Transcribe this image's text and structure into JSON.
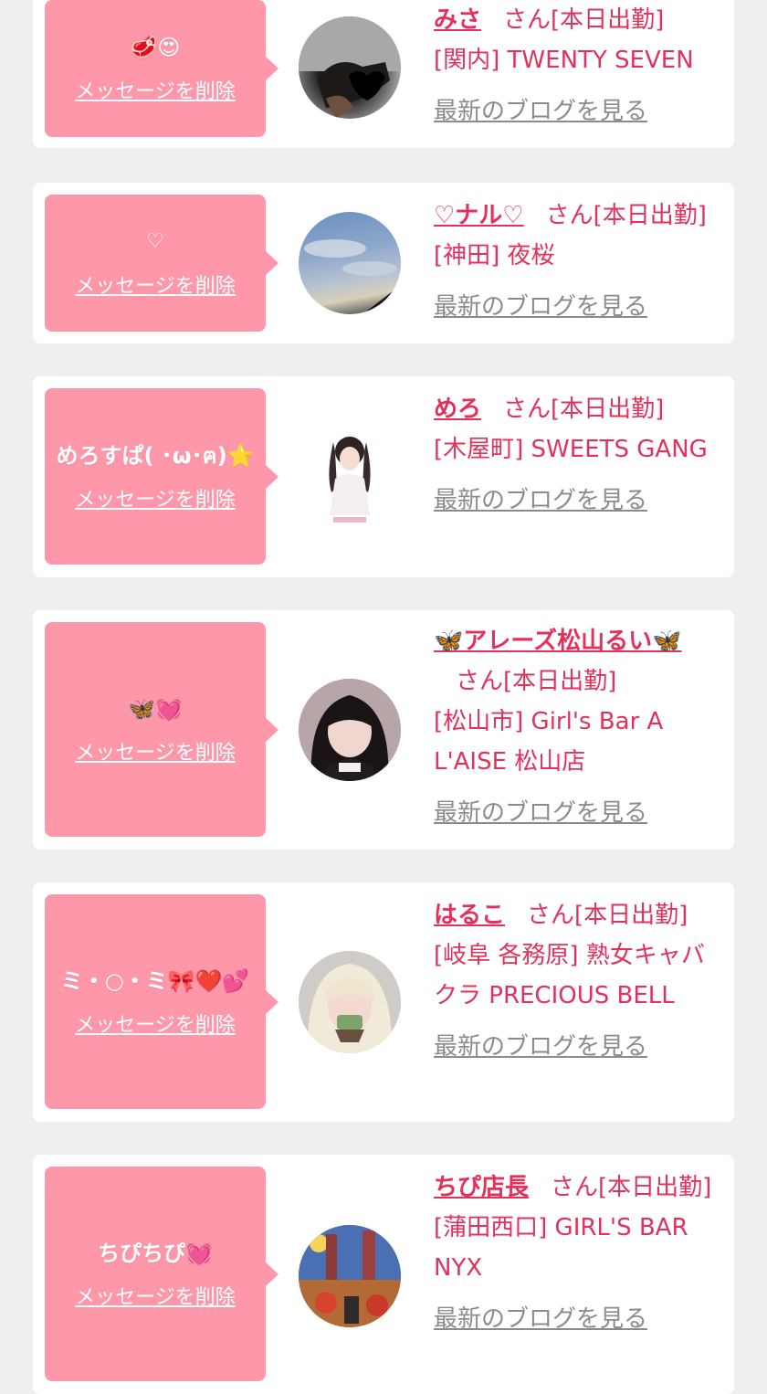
{
  "common": {
    "delete_label": "メッセージを削除",
    "san_suffix": "さん[本日出勤]",
    "blog_link": "最新のブログを見る"
  },
  "cards": [
    {
      "message": "🥩😍",
      "name": "みさ",
      "shop": "[関内] TWENTY SEVEN"
    },
    {
      "message": "♡",
      "name": "♡ナル♡",
      "shop": "[神田] 夜桜"
    },
    {
      "message": "めろすぱ( ･ω･ฅ)⭐",
      "name": "めろ",
      "shop": "[木屋町] SWEETS GANG"
    },
    {
      "message": "🦋💓",
      "name": "🦋アレーズ松山るい🦋",
      "shop": "[松山市] Girl's Bar A L'AISE 松山店"
    },
    {
      "message": "ミ・○・ミ🎀❤️💕",
      "name": "はるこ",
      "shop": "[岐阜 各務原]  熟女キャバクラ PRECIOUS BELL"
    },
    {
      "message": "ちぴちぴ💓",
      "name": "ちぴ店長",
      "shop": "[蒲田西口] GIRL'S BAR NYX"
    }
  ]
}
